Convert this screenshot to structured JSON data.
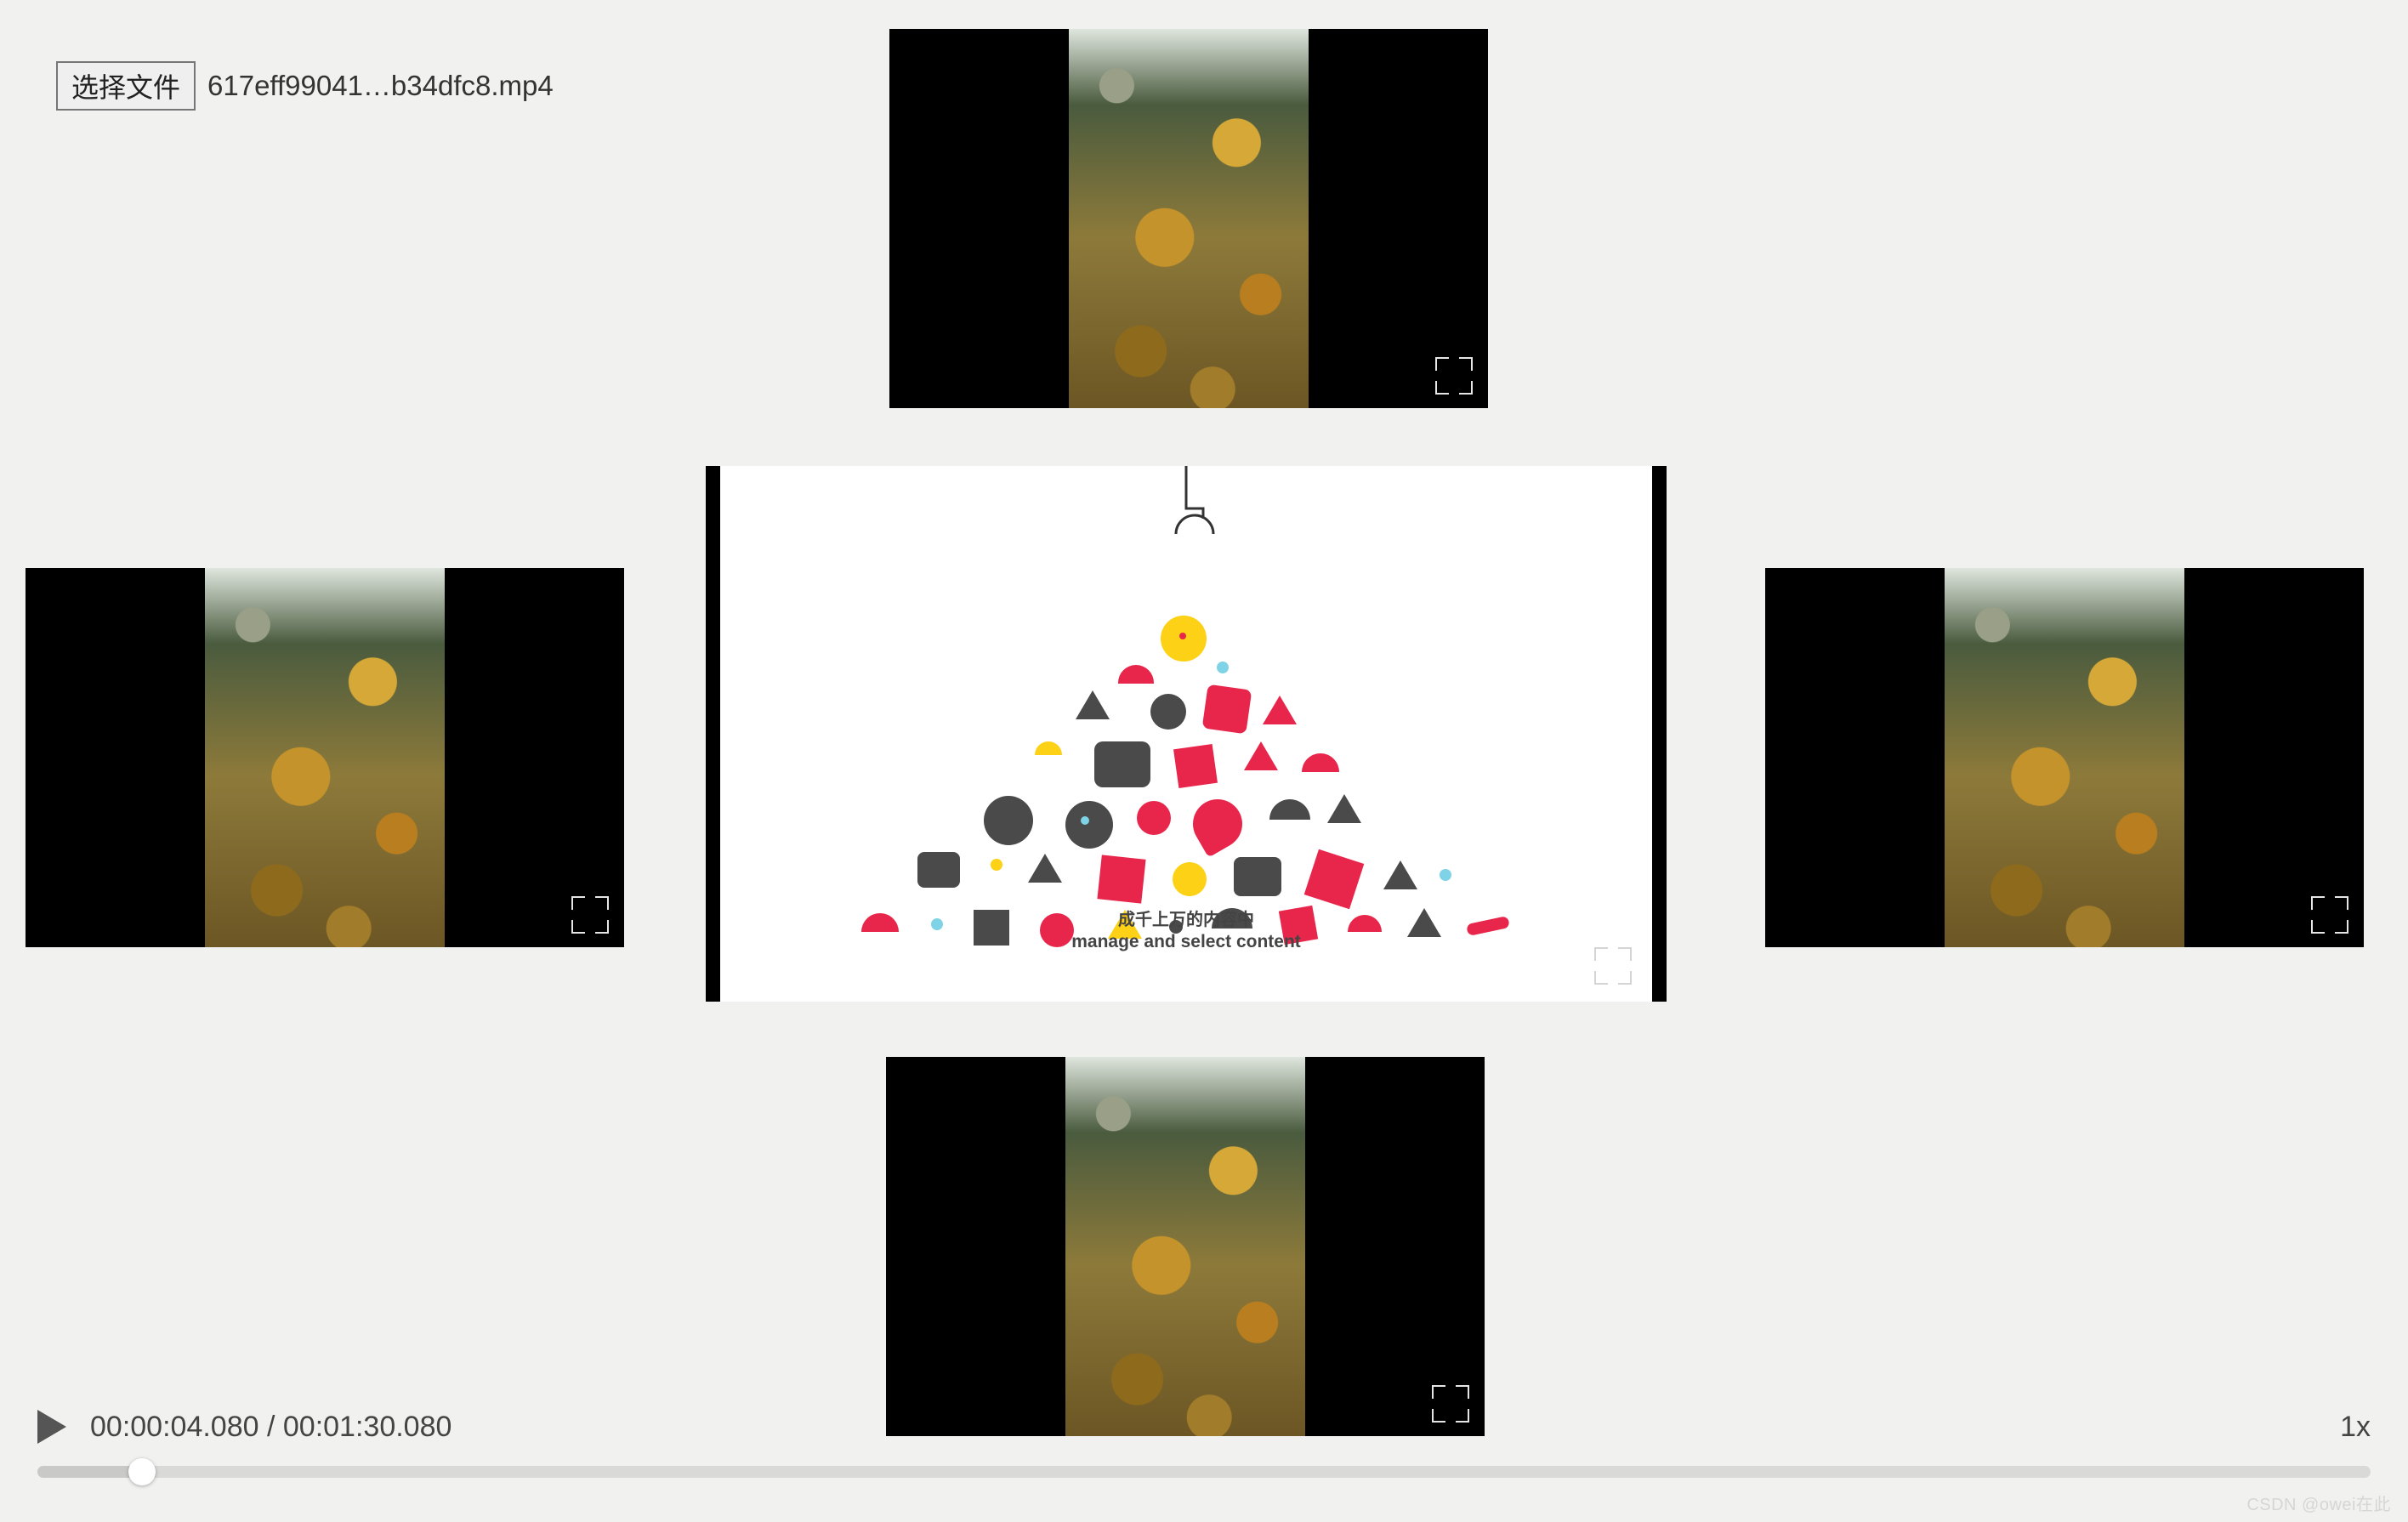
{
  "file_picker": {
    "button_label": "选择文件",
    "selected_filename": "617eff99041…b34dfc8.mp4"
  },
  "center_video": {
    "caption_cn": "成千上万的内容中",
    "caption_en": "manage and select content"
  },
  "player": {
    "current_time": "00:00:04.080",
    "duration": "00:01:30.080",
    "separator": " / ",
    "speed": "1x",
    "progress_percent": 4.5
  },
  "watermark": "CSDN @owei在此",
  "colors": {
    "bg": "#f1f1ef",
    "accent_red": "#e8264b",
    "accent_yellow": "#fdd116",
    "accent_cyan": "#7fd3e6",
    "neutral_dark": "#4a4a4a"
  }
}
